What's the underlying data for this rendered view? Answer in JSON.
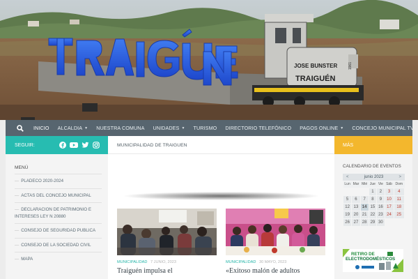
{
  "hero": {
    "sign_text": "TRAIGUÉN",
    "loco_plate_line1": "JOSE BUNSTER",
    "loco_plate_line2": "TRAIGUÉN",
    "loco_number": "1961"
  },
  "nav": {
    "items": [
      {
        "label": "INICIO",
        "dropdown": false
      },
      {
        "label": "ALCALDIA",
        "dropdown": true
      },
      {
        "label": "NUESTRA COMUNA",
        "dropdown": false
      },
      {
        "label": "UNIDADES",
        "dropdown": true
      },
      {
        "label": "TURISMO",
        "dropdown": false
      },
      {
        "label": "DIRECTORIO TELEFÓNICO",
        "dropdown": false
      },
      {
        "label": "PAGOS ONLINE",
        "dropdown": true
      },
      {
        "label": "CONCEJO MUNICIPAL TV",
        "dropdown": false
      }
    ],
    "search_icon": "search-icon"
  },
  "left_bar": {
    "label": "SEGUIR:",
    "icons": [
      "facebook-icon",
      "youtube-icon",
      "twitter-icon",
      "instagram-icon"
    ]
  },
  "right_bar": {
    "label": "MÁS"
  },
  "left_sidebar": {
    "title": "MENÚ",
    "items": [
      {
        "label": "PLADECO 2020-2024"
      },
      {
        "label": "ACTAS DEL CONCEJO MUNICIPAL"
      },
      {
        "label": "DECLARACION DE PATRIMONIO E INTERESES LEY N 20880"
      },
      {
        "label": "CONSEJO DE SEGURIDAD PUBLICA"
      },
      {
        "label": "CONSEJO DE LA SOCIEDAD CIVIL"
      },
      {
        "label": "MAPA"
      }
    ]
  },
  "main": {
    "heading": "MUNICIPALIDAD DE TRAIGUEN",
    "posts": [
      {
        "category": "MUNICIPALIDAD",
        "date": "7 JUNIO, 2023",
        "title": "Traiguén impulsa el"
      },
      {
        "category": "MUNICIPALIDAD",
        "date": "30 MAYO, 2023",
        "title": "«Exitoso malón de adultos"
      }
    ]
  },
  "right_sidebar": {
    "title": "CALENDARIO DE EVENTOS",
    "calendar": {
      "month": "junio 2023",
      "prev": "<",
      "next": ">",
      "weekdays": [
        "Lun",
        "Mar",
        "Mié",
        "Jue",
        "Vie",
        "Sáb",
        "Dom"
      ],
      "weeks": [
        [
          "",
          "",
          "",
          "1",
          "2",
          "3",
          "4"
        ],
        [
          "5",
          "6",
          "7",
          "8",
          "9",
          "10",
          "11"
        ],
        [
          "12",
          "13",
          "14",
          "15",
          "16",
          "17",
          "18"
        ],
        [
          "19",
          "20",
          "21",
          "22",
          "23",
          "24",
          "25"
        ],
        [
          "26",
          "27",
          "28",
          "29",
          "30",
          "",
          ""
        ]
      ],
      "today": "14"
    },
    "banner": {
      "line1": "RETIRO DE",
      "line2": "ELECTRODOMÉSTICOS"
    }
  },
  "colors": {
    "nav_bg": "#57656f",
    "teal": "#27bcb1",
    "yellow": "#f3b72d",
    "accent_blue": "#2a56e0"
  }
}
